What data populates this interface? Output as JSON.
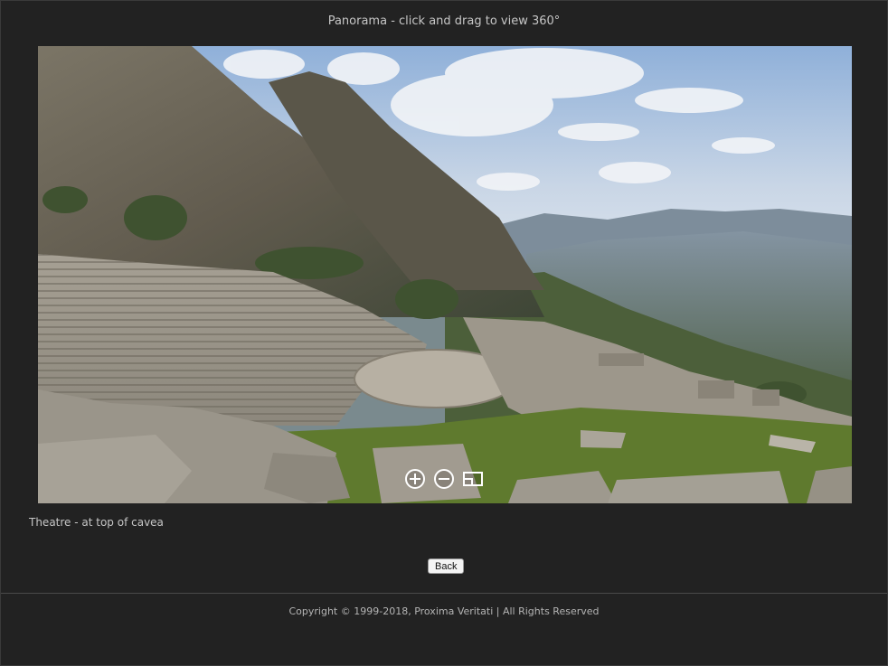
{
  "header": {
    "title": "Panorama - click and drag to view 360°"
  },
  "panorama": {
    "controls": {
      "zoom_in_icon": "circle-plus-icon",
      "zoom_out_icon": "circle-minus-icon",
      "fullscreen_icon": "fullscreen-icon"
    }
  },
  "caption": "Theatre - at top of cavea",
  "back_button": "Back",
  "footer": {
    "copyright": "Copyright © 1999-2018, Proxima Veritati | All Rights Reserved"
  },
  "colors": {
    "background": "#222222",
    "text": "#c6c6c6",
    "sky": "#9fb8d8",
    "stone": "#a9a49a",
    "grass": "#5f7a2e"
  }
}
